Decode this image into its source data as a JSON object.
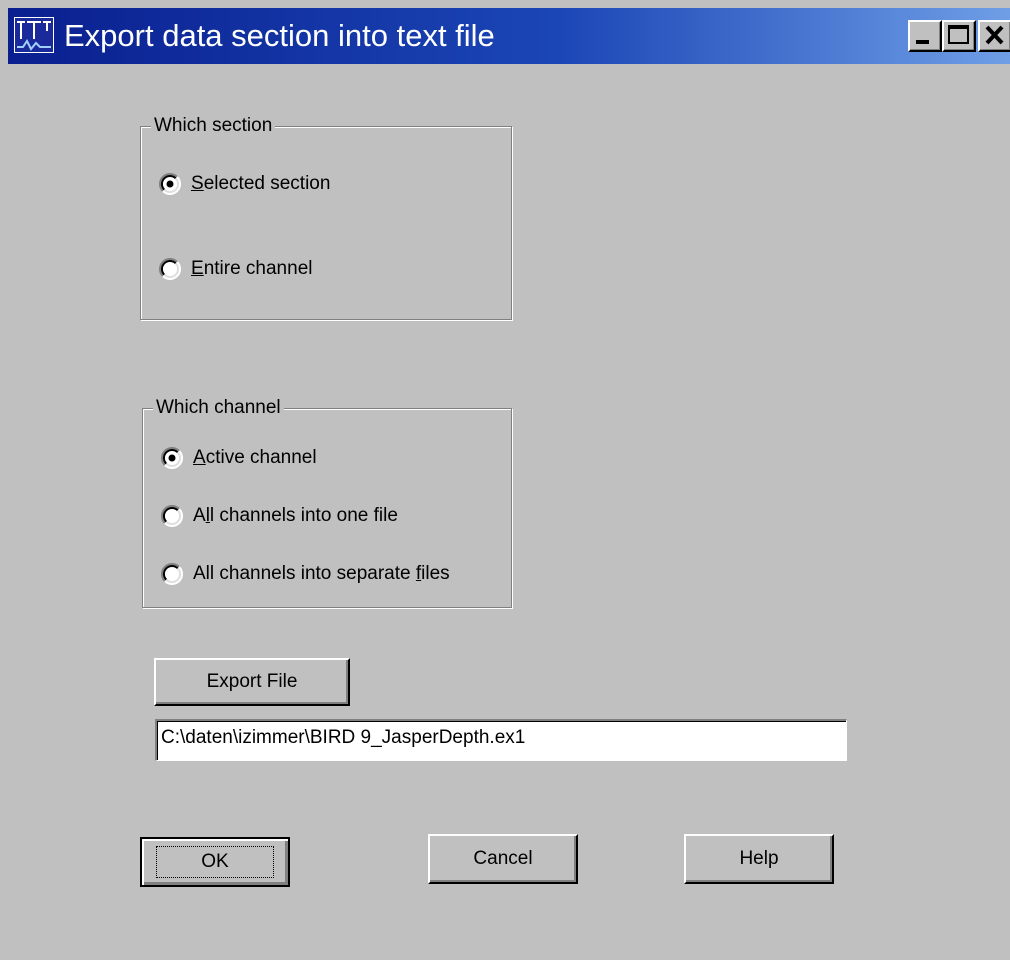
{
  "window": {
    "title": "Export data section into text file",
    "app_icon": "app-logo-icon",
    "controls": [
      "minimize-icon",
      "maximize-icon",
      "close-icon"
    ]
  },
  "section_group": {
    "legend": "Which section",
    "options": [
      {
        "label_accel": "S",
        "label_rest": "elected section",
        "selected": true
      },
      {
        "label_accel": "E",
        "label_rest": "ntire channel",
        "selected": false
      }
    ]
  },
  "channel_group": {
    "legend": "Which channel",
    "options": [
      {
        "label_pre": "",
        "label_accel": "A",
        "label_rest": "ctive channel",
        "selected": true
      },
      {
        "label_pre": "A",
        "label_accel": "l",
        "label_rest": "l channels into one file",
        "selected": false
      },
      {
        "label_pre": "All channels into separate ",
        "label_accel": "f",
        "label_rest": "iles",
        "selected": false
      }
    ]
  },
  "export": {
    "button_label": "Export File",
    "file_path": "C:\\daten\\izimmer\\BIRD 9_JasperDepth.ex1"
  },
  "buttons": {
    "ok": "OK",
    "cancel": "Cancel",
    "help": "Help"
  },
  "colors": {
    "face": "#c0c0c0",
    "title_start": "#0a1f8f",
    "title_end": "#6f9ee6"
  }
}
